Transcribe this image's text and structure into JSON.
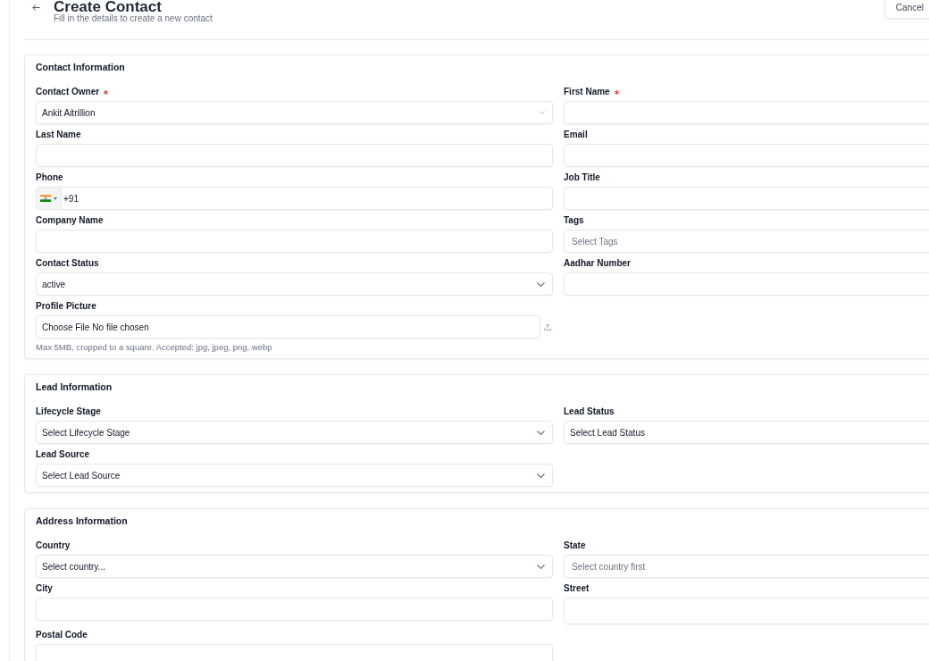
{
  "header": {
    "title": "Create Contact",
    "subtitle": "Fill in the details to create a new contact",
    "cancel_label": "Cancel"
  },
  "sections": [
    {
      "title": "Contact Information",
      "fields": [
        {
          "kind": "combobox",
          "label": "Contact Owner",
          "required": true,
          "value": "Ankit Aitrillion"
        },
        {
          "kind": "text",
          "label": "First Name",
          "required": true
        },
        {
          "kind": "text",
          "label": "Last Name",
          "required": false
        },
        {
          "kind": "text",
          "label": "Email",
          "required": false
        },
        {
          "kind": "phone",
          "label": "Phone",
          "required": false,
          "value": "+91"
        },
        {
          "kind": "text",
          "label": "Job Title",
          "required": false
        },
        {
          "kind": "text",
          "label": "Company Name",
          "required": false
        },
        {
          "kind": "text",
          "label": "Tags",
          "required": false,
          "placeholder": "Select Tags"
        },
        {
          "kind": "select",
          "label": "Contact Status",
          "required": false,
          "value": "active"
        },
        {
          "kind": "text",
          "label": "Aadhar Number",
          "required": false
        },
        {
          "kind": "file",
          "label": "Profile Picture",
          "required": false,
          "button": "Choose File",
          "value": "No file chosen",
          "hint": "Max 5MB, cropped to a square. Accepted: jpg, jpeg, png, webp"
        }
      ]
    },
    {
      "title": "Lead Information",
      "fields": [
        {
          "kind": "select",
          "label": "Lifecycle Stage",
          "required": false,
          "value": "Select Lifecycle Stage"
        },
        {
          "kind": "value",
          "label": "Lead Status",
          "required": false,
          "value": "Select Lead Status"
        },
        {
          "kind": "select",
          "label": "Lead Source",
          "required": false,
          "value": "Select Lead Source"
        }
      ]
    },
    {
      "title": "Address Information",
      "fields": [
        {
          "kind": "select",
          "label": "Country",
          "required": false,
          "value": "Select country..."
        },
        {
          "kind": "text",
          "label": "State",
          "required": false,
          "placeholder": "Select country first"
        },
        {
          "kind": "text",
          "label": "City",
          "required": false
        },
        {
          "kind": "textarea",
          "label": "Street",
          "required": false
        },
        {
          "kind": "text",
          "label": "Postal Code",
          "required": false
        }
      ]
    }
  ]
}
